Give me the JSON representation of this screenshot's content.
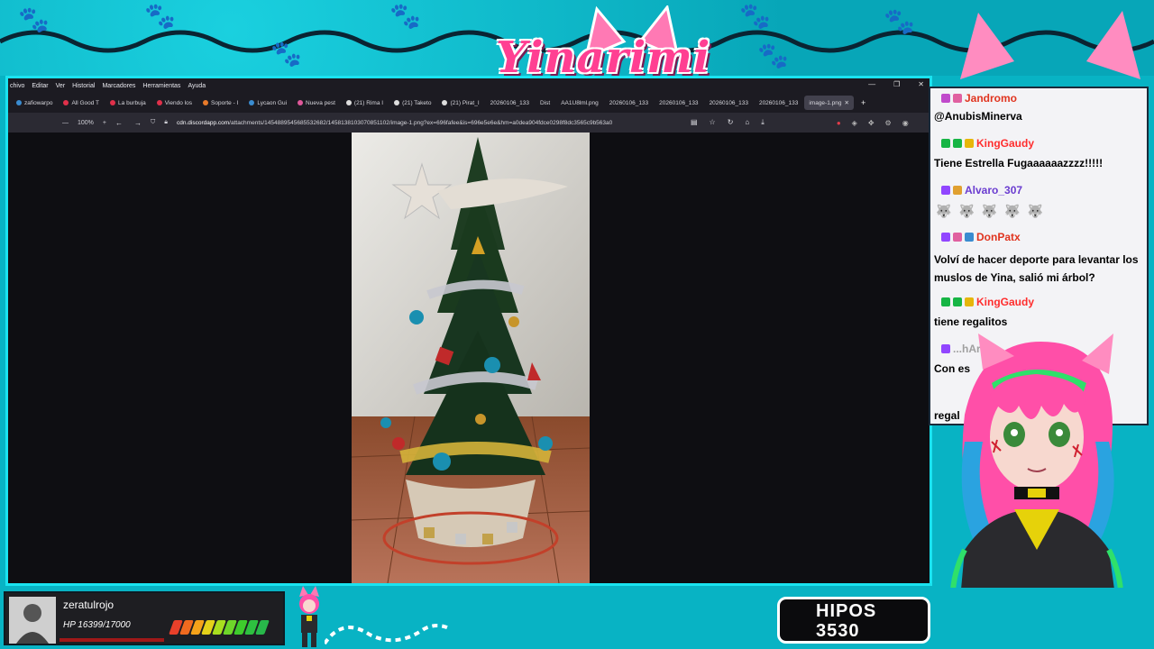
{
  "overlay": {
    "logo_text": "Yinarimi"
  },
  "browser": {
    "menu": [
      "chivo",
      "Editar",
      "Ver",
      "Historial",
      "Marcadores",
      "Herramientas",
      "Ayuda"
    ],
    "tabs": [
      {
        "label": "zafiowarpo"
      },
      {
        "label": "All Good T"
      },
      {
        "label": "La burbuja"
      },
      {
        "label": "Viendo los"
      },
      {
        "label": "Soporte - I"
      },
      {
        "label": "Lycaon Gui"
      },
      {
        "label": "Nueva pest"
      },
      {
        "label": "(21) Rima I"
      },
      {
        "label": "(21) Taketo"
      },
      {
        "label": "(21) Pirat_I"
      },
      {
        "label": "20260106_133"
      },
      {
        "label": "Dist"
      },
      {
        "label": "AA1U8lml.png"
      },
      {
        "label": "20260106_133"
      },
      {
        "label": "20260106_133"
      },
      {
        "label": "20260106_133"
      },
      {
        "label": "20260106_133"
      },
      {
        "label": "20260106_133"
      }
    ],
    "active_tab": "image-1.png",
    "zoom": "100%",
    "url_domain": "cdn.discordapp.com",
    "url_rest": "/attachments/1454889545685532682/1458138103070851102/image-1.png?ex=696fafee&is=696e5e6e&hm=a0dea904fdce0298f8dc3565c9b563a0"
  },
  "chat": {
    "messages": [
      {
        "user": "Jandromo",
        "color": "#e0341f",
        "text": "@AnubisMinerva"
      },
      {
        "user": "KingGaudy",
        "color": "#ff2d2d",
        "text": "Tiene Estrella Fugaaaaaazzzz!!!!!"
      },
      {
        "user": "Alvaro_307",
        "color": "#6a3cd0",
        "text": ""
      },
      {
        "user": "DonPatx",
        "color": "#e0341f",
        "text": "Volví de hacer deporte para levantar los muslos de Yina, salió mi árbol?"
      },
      {
        "user": "KingGaudy",
        "color": "#ff2d2d",
        "text": "tiene regalitos"
      },
      {
        "user": "...hArt",
        "color": "#a0a0a0",
        "text": "Con es"
      },
      {
        "user": "",
        "color": "#a0a0a0",
        "text": "regal"
      }
    ]
  },
  "player": {
    "name": "zeratulrojo",
    "hp": "HP 16399/17000",
    "hp_fraction": 0.965
  },
  "hipos": {
    "label": "HIPOS",
    "value": "3530"
  }
}
